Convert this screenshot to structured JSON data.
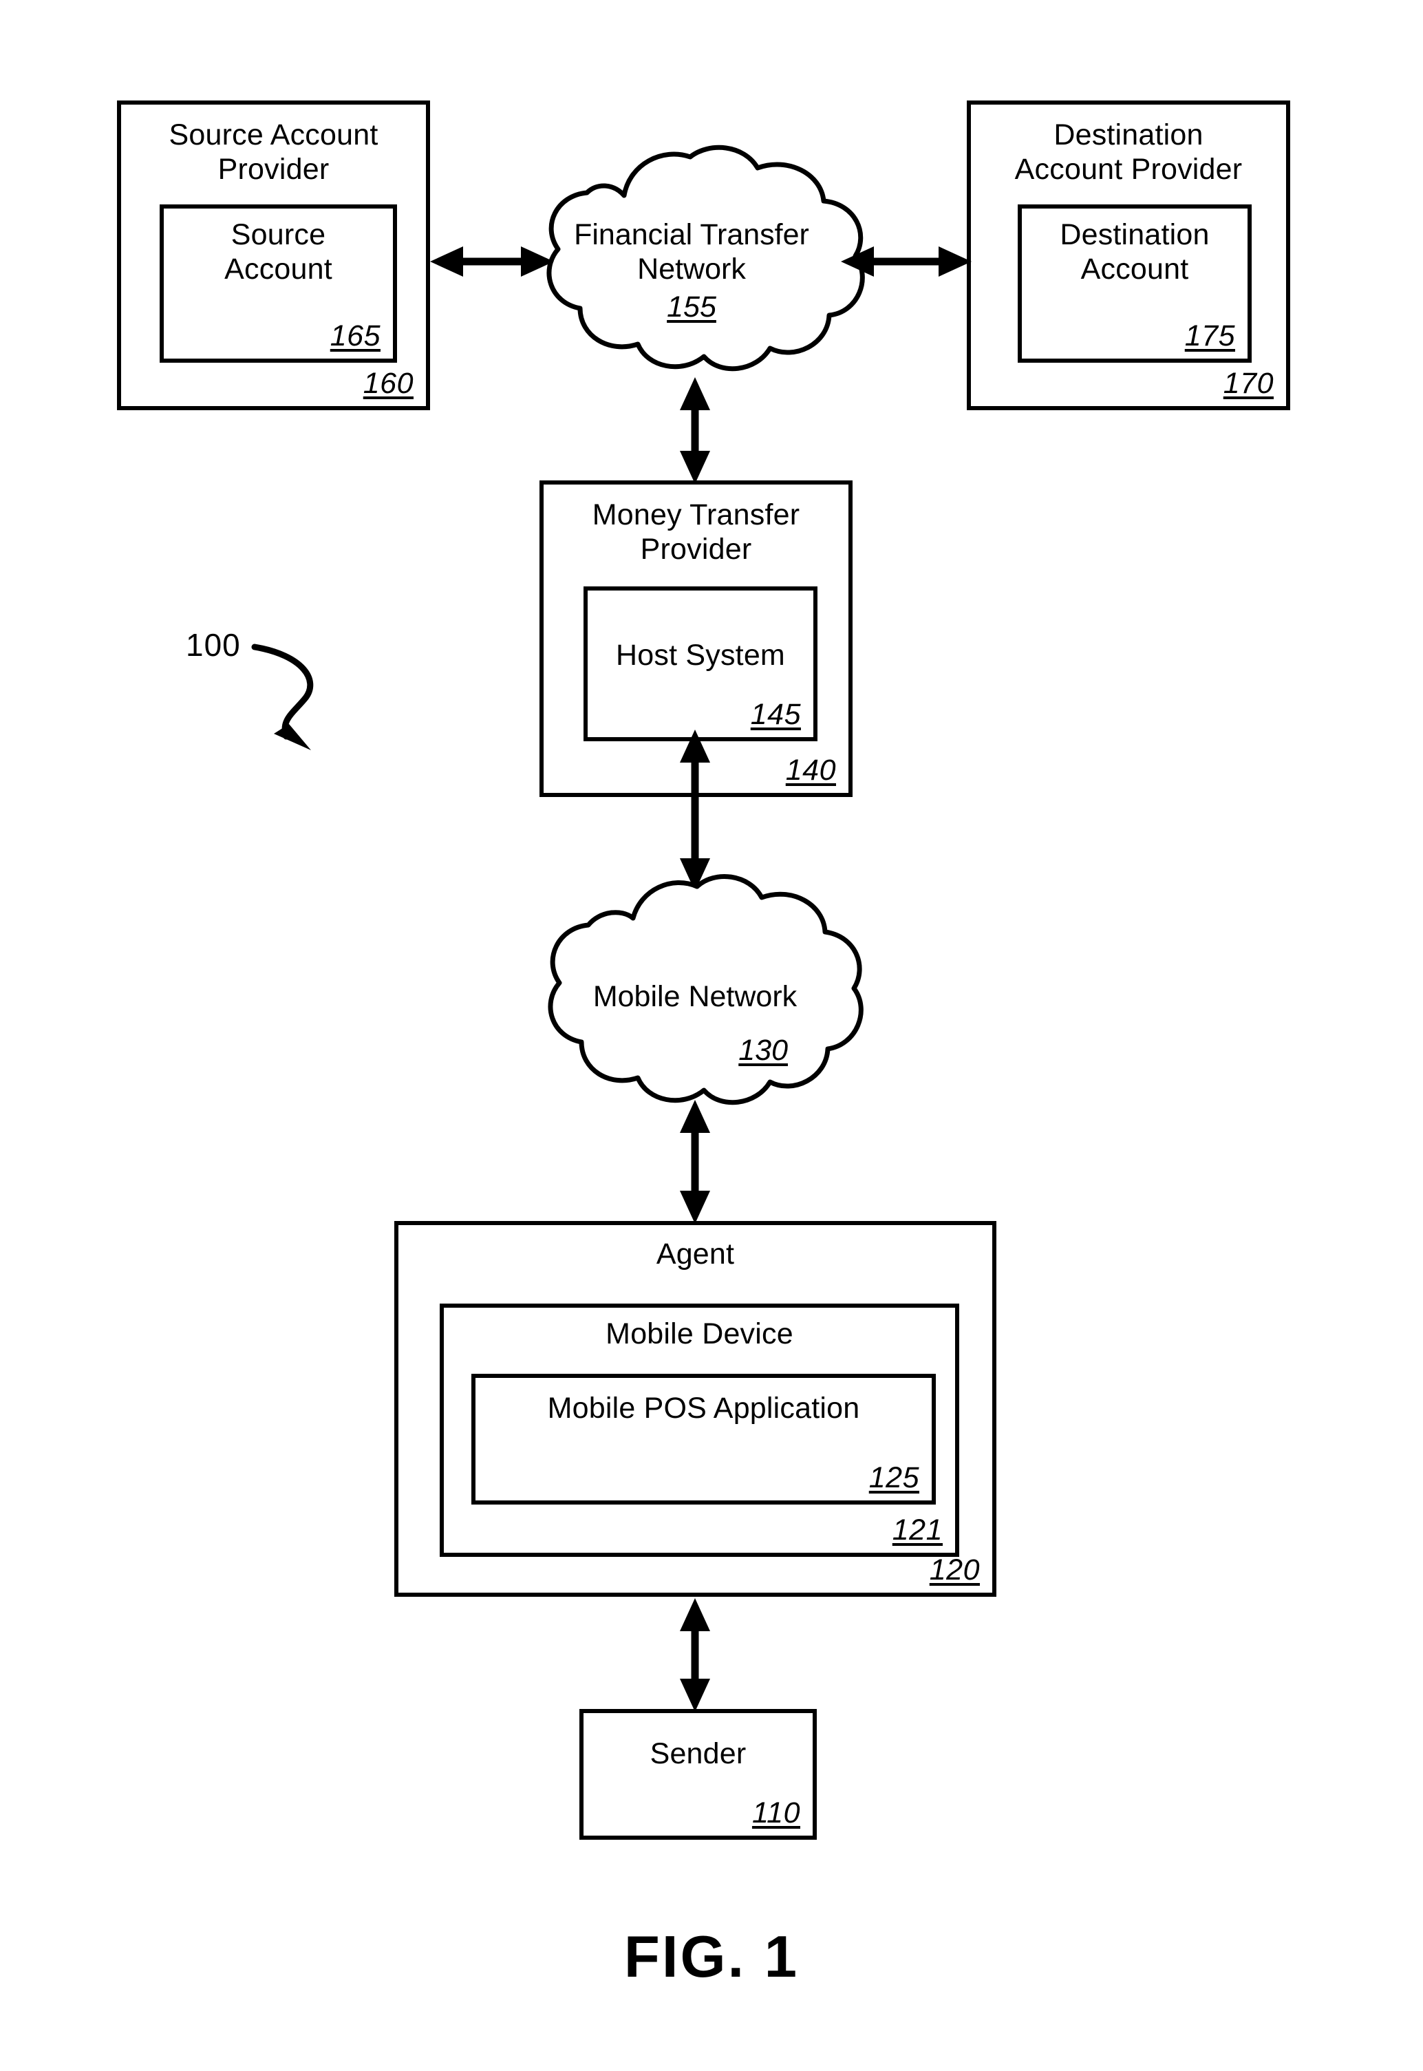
{
  "figure": {
    "caption": "FIG. 1",
    "system_ref": "100"
  },
  "nodes": {
    "source_account_provider": {
      "label": "Source Account\nProvider",
      "ref": "160"
    },
    "source_account": {
      "label": "Source\nAccount",
      "ref": "165"
    },
    "financial_transfer_network": {
      "label": "Financial Transfer\nNetwork",
      "ref": "155"
    },
    "destination_account_provider": {
      "label": "Destination\nAccount Provider",
      "ref": "170"
    },
    "destination_account": {
      "label": "Destination\nAccount",
      "ref": "175"
    },
    "money_transfer_provider": {
      "label": "Money Transfer\nProvider",
      "ref": "140"
    },
    "host_system": {
      "label": "Host System",
      "ref": "145"
    },
    "mobile_network": {
      "label": "Mobile Network",
      "ref": "130"
    },
    "agent": {
      "label": "Agent",
      "ref": "120"
    },
    "mobile_device": {
      "label": "Mobile Device",
      "ref": "121"
    },
    "mobile_pos_application": {
      "label": "Mobile POS Application",
      "ref": "125"
    },
    "sender": {
      "label": "Sender",
      "ref": "110"
    }
  },
  "connectors": [
    {
      "name": "source-provider-to-financial-network",
      "kind": "double-arrow-horizontal"
    },
    {
      "name": "financial-network-to-destination-provider",
      "kind": "double-arrow-horizontal"
    },
    {
      "name": "financial-network-to-money-transfer-provider",
      "kind": "double-arrow-vertical"
    },
    {
      "name": "host-system-to-mobile-network",
      "kind": "double-arrow-vertical"
    },
    {
      "name": "mobile-network-to-agent",
      "kind": "double-arrow-vertical"
    },
    {
      "name": "agent-to-sender",
      "kind": "double-arrow-vertical"
    },
    {
      "name": "system-ref-pointer",
      "kind": "curved-arrow"
    }
  ],
  "style": {
    "stroke": "#000000",
    "background": "#ffffff"
  }
}
